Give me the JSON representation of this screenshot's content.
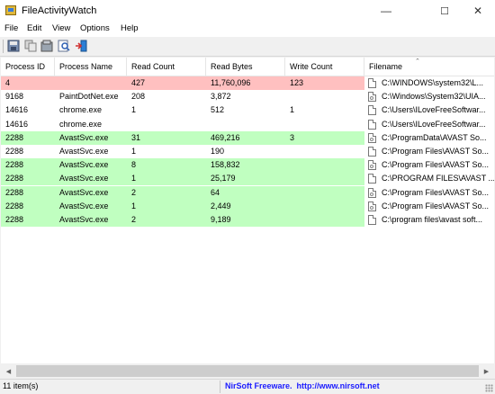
{
  "window": {
    "title": "FileActivityWatch",
    "minimize": "—",
    "maximize": "☐",
    "close": "✕"
  },
  "menu": [
    "File",
    "Edit",
    "View",
    "Options",
    "Help"
  ],
  "toolbar": {
    "buttons": [
      "save-icon",
      "copy-icon",
      "properties-icon",
      "find-icon",
      "exit-icon"
    ]
  },
  "columns": [
    "Process ID",
    "Process Name",
    "Read Count",
    "Read Bytes",
    "Write Count",
    "Filename"
  ],
  "sort_indicator": "⌃",
  "rows": [
    {
      "pid": "4",
      "name": "",
      "read_count": "427",
      "read_bytes": "11,760,096",
      "write_count": "123",
      "filename": "C:\\WINDOWS\\system32\\L...",
      "color": "#ffc0c0",
      "icon": "doc"
    },
    {
      "pid": "9168",
      "name": "PaintDotNet.exe",
      "read_count": "208",
      "read_bytes": "3,872",
      "write_count": "",
      "filename": "C:\\Windows\\System32\\UIA...",
      "color": "#ffffff",
      "icon": "gear"
    },
    {
      "pid": "14616",
      "name": "chrome.exe",
      "read_count": "1",
      "read_bytes": "512",
      "write_count": "1",
      "filename": "C:\\Users\\ILoveFreeSoftwar...",
      "color": "#ffffff",
      "icon": "doc"
    },
    {
      "pid": "14616",
      "name": "chrome.exe",
      "read_count": "",
      "read_bytes": "",
      "write_count": "",
      "filename": "C:\\Users\\ILoveFreeSoftwar...",
      "color": "#ffffff",
      "icon": "doc"
    },
    {
      "pid": "2288",
      "name": "AvastSvc.exe",
      "read_count": "31",
      "read_bytes": "469,216",
      "write_count": "3",
      "filename": "C:\\ProgramData\\AVAST So...",
      "color": "#c0ffc0",
      "icon": "gear"
    },
    {
      "pid": "2288",
      "name": "AvastSvc.exe",
      "read_count": "1",
      "read_bytes": "190",
      "write_count": "",
      "filename": "C:\\Program Files\\AVAST So...",
      "color": "#ffffff",
      "icon": "doc"
    },
    {
      "pid": "2288",
      "name": "AvastSvc.exe",
      "read_count": "8",
      "read_bytes": "158,832",
      "write_count": "",
      "filename": "C:\\Program Files\\AVAST So...",
      "color": "#c0ffc0",
      "icon": "gear"
    },
    {
      "pid": "2288",
      "name": "AvastSvc.exe",
      "read_count": "1",
      "read_bytes": "25,179",
      "write_count": "",
      "filename": "C:\\PROGRAM FILES\\AVAST ...",
      "color": "#c0ffc0",
      "icon": "doc"
    },
    {
      "pid": "2288",
      "name": "AvastSvc.exe",
      "read_count": "2",
      "read_bytes": "64",
      "write_count": "",
      "filename": "C:\\Program Files\\AVAST So...",
      "color": "#c0ffc0",
      "icon": "gear"
    },
    {
      "pid": "2288",
      "name": "AvastSvc.exe",
      "read_count": "1",
      "read_bytes": "2,449",
      "write_count": "",
      "filename": "C:\\Program Files\\AVAST So...",
      "color": "#c0ffc0",
      "icon": "gear"
    },
    {
      "pid": "2288",
      "name": "AvastSvc.exe",
      "read_count": "2",
      "read_bytes": "9,189",
      "write_count": "",
      "filename": "C:\\program files\\avast soft...",
      "color": "#c0ffc0",
      "icon": "doc"
    }
  ],
  "scrollbar": {
    "left_arrow": "◀",
    "right_arrow": "▶"
  },
  "status": {
    "count": "11 item(s)",
    "link": "NirSoft Freeware.  http://www.nirsoft.net"
  }
}
